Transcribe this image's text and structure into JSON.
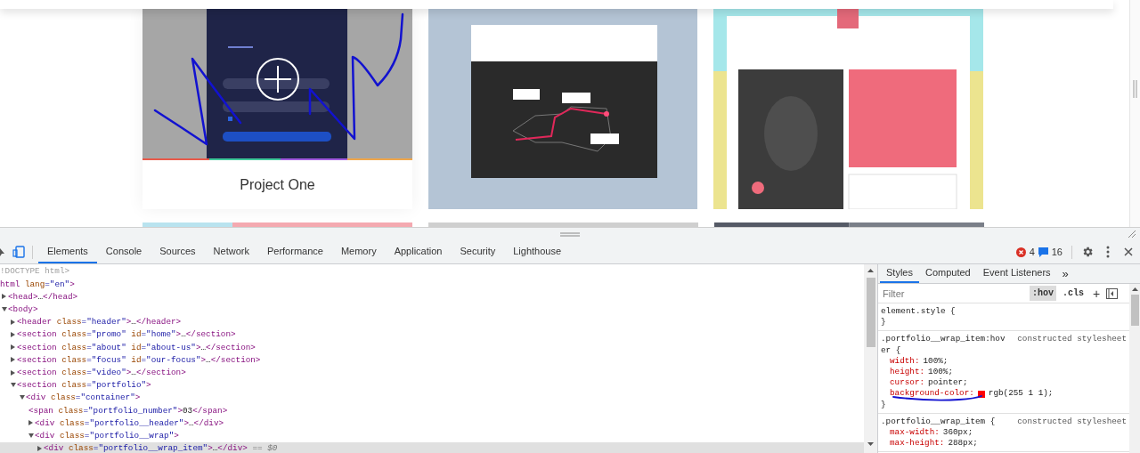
{
  "page": {
    "cards": [
      {
        "title": "Project One"
      }
    ]
  },
  "devtools": {
    "tabs": [
      {
        "label": "Elements",
        "selected": true
      },
      {
        "label": "Console",
        "selected": false
      },
      {
        "label": "Sources",
        "selected": false
      },
      {
        "label": "Network",
        "selected": false
      },
      {
        "label": "Performance",
        "selected": false
      },
      {
        "label": "Memory",
        "selected": false
      },
      {
        "label": "Application",
        "selected": false
      },
      {
        "label": "Security",
        "selected": false
      },
      {
        "label": "Lighthouse",
        "selected": false
      }
    ],
    "errors": "4",
    "messages": "16",
    "tree": [
      {
        "kind": "plain",
        "selected": false,
        "parts": [
          {
            "kind": "dim",
            "text": "!DOCTYPE html>"
          }
        ]
      },
      {
        "kind": "plain",
        "selected": false,
        "parts": [
          {
            "kind": "tag",
            "text": "html"
          },
          {
            "kind": "attr",
            "text": " lang"
          },
          {
            "kind": "value",
            "text": "=\"en\""
          },
          {
            "kind": "tag",
            "text": ">"
          }
        ],
        "children": [
          {
            "kind": "toggle",
            "expanded": false,
            "selected": false,
            "parts": [
              {
                "kind": "tag",
                "text": "<head>"
              },
              {
                "kind": "text",
                "text": "…"
              },
              {
                "kind": "tag",
                "text": "</head>"
              }
            ]
          },
          {
            "kind": "toggle",
            "expanded": true,
            "selected": false,
            "parts": [
              {
                "kind": "tag",
                "text": "<body>"
              }
            ],
            "children": [
              {
                "kind": "toggle",
                "expanded": false,
                "selected": false,
                "parts": [
                  {
                    "kind": "tag",
                    "text": "<header"
                  },
                  {
                    "kind": "attr",
                    "text": " class"
                  },
                  {
                    "kind": "value",
                    "text": "=\"header\""
                  },
                  {
                    "kind": "tag",
                    "text": ">"
                  },
                  {
                    "kind": "text",
                    "text": "…"
                  },
                  {
                    "kind": "tag",
                    "text": "</header>"
                  }
                ]
              },
              {
                "kind": "toggle",
                "expanded": false,
                "selected": false,
                "parts": [
                  {
                    "kind": "tag",
                    "text": "<section"
                  },
                  {
                    "kind": "attr",
                    "text": " class"
                  },
                  {
                    "kind": "value",
                    "text": "=\"promo\""
                  },
                  {
                    "kind": "attr",
                    "text": " id"
                  },
                  {
                    "kind": "value",
                    "text": "=\"home\""
                  },
                  {
                    "kind": "tag",
                    "text": ">"
                  },
                  {
                    "kind": "text",
                    "text": "…"
                  },
                  {
                    "kind": "tag",
                    "text": "</section>"
                  }
                ]
              },
              {
                "kind": "toggle",
                "expanded": false,
                "selected": false,
                "parts": [
                  {
                    "kind": "tag",
                    "text": "<section"
                  },
                  {
                    "kind": "attr",
                    "text": " class"
                  },
                  {
                    "kind": "value",
                    "text": "=\"about\""
                  },
                  {
                    "kind": "attr",
                    "text": " id"
                  },
                  {
                    "kind": "value",
                    "text": "=\"about-us\""
                  },
                  {
                    "kind": "tag",
                    "text": ">"
                  },
                  {
                    "kind": "text",
                    "text": "…"
                  },
                  {
                    "kind": "tag",
                    "text": "</section>"
                  }
                ]
              },
              {
                "kind": "toggle",
                "expanded": false,
                "selected": false,
                "parts": [
                  {
                    "kind": "tag",
                    "text": "<section"
                  },
                  {
                    "kind": "attr",
                    "text": " class"
                  },
                  {
                    "kind": "value",
                    "text": "=\"focus\""
                  },
                  {
                    "kind": "attr",
                    "text": " id"
                  },
                  {
                    "kind": "value",
                    "text": "=\"our-focus\""
                  },
                  {
                    "kind": "tag",
                    "text": ">"
                  },
                  {
                    "kind": "text",
                    "text": "…"
                  },
                  {
                    "kind": "tag",
                    "text": "</section>"
                  }
                ]
              },
              {
                "kind": "toggle",
                "expanded": false,
                "selected": false,
                "parts": [
                  {
                    "kind": "tag",
                    "text": "<section"
                  },
                  {
                    "kind": "attr",
                    "text": " class"
                  },
                  {
                    "kind": "value",
                    "text": "=\"video\""
                  },
                  {
                    "kind": "tag",
                    "text": ">"
                  },
                  {
                    "kind": "text",
                    "text": "…"
                  },
                  {
                    "kind": "tag",
                    "text": "</section>"
                  }
                ]
              },
              {
                "kind": "toggle",
                "expanded": true,
                "selected": false,
                "parts": [
                  {
                    "kind": "tag",
                    "text": "<section"
                  },
                  {
                    "kind": "attr",
                    "text": " class"
                  },
                  {
                    "kind": "value",
                    "text": "=\"portfolio\""
                  },
                  {
                    "kind": "tag",
                    "text": ">"
                  }
                ],
                "children": [
                  {
                    "kind": "toggle",
                    "expanded": true,
                    "selected": false,
                    "parts": [
                      {
                        "kind": "tag",
                        "text": "<div"
                      },
                      {
                        "kind": "attr",
                        "text": " class"
                      },
                      {
                        "kind": "value",
                        "text": "=\"container\""
                      },
                      {
                        "kind": "tag",
                        "text": ">"
                      }
                    ],
                    "children": [
                      {
                        "kind": "plain",
                        "selected": false,
                        "parts": [
                          {
                            "kind": "tag",
                            "text": "<span"
                          },
                          {
                            "kind": "attr",
                            "text": " class"
                          },
                          {
                            "kind": "value",
                            "text": "=\"portfolio_number\""
                          },
                          {
                            "kind": "tag",
                            "text": ">"
                          },
                          {
                            "kind": "text",
                            "text": "03"
                          },
                          {
                            "kind": "tag",
                            "text": "</span>"
                          }
                        ]
                      },
                      {
                        "kind": "toggle",
                        "expanded": false,
                        "selected": false,
                        "parts": [
                          {
                            "kind": "tag",
                            "text": "<div"
                          },
                          {
                            "kind": "attr",
                            "text": " class"
                          },
                          {
                            "kind": "value",
                            "text": "=\"portfolio__header\""
                          },
                          {
                            "kind": "tag",
                            "text": ">"
                          },
                          {
                            "kind": "text",
                            "text": "…"
                          },
                          {
                            "kind": "tag",
                            "text": "</div>"
                          }
                        ]
                      },
                      {
                        "kind": "toggle",
                        "expanded": true,
                        "selected": false,
                        "parts": [
                          {
                            "kind": "tag",
                            "text": "<div"
                          },
                          {
                            "kind": "attr",
                            "text": " class"
                          },
                          {
                            "kind": "value",
                            "text": "=\"portfolio__wrap\""
                          },
                          {
                            "kind": "tag",
                            "text": ">"
                          }
                        ],
                        "children": [
                          {
                            "kind": "toggle",
                            "expanded": false,
                            "selected": true,
                            "parts": [
                              {
                                "kind": "tag",
                                "text": "<div"
                              },
                              {
                                "kind": "attr",
                                "text": " class"
                              },
                              {
                                "kind": "value",
                                "text": "=\"portfolio__wrap_item\""
                              },
                              {
                                "kind": "tag",
                                "text": ">"
                              },
                              {
                                "kind": "text",
                                "text": "…"
                              },
                              {
                                "kind": "tag",
                                "text": "</div>"
                              },
                              {
                                "kind": "note",
                                "text": " == $0"
                              }
                            ]
                          }
                        ]
                      }
                    ]
                  }
                ]
              }
            ]
          }
        ]
      }
    ],
    "sidebar": {
      "tabs": [
        {
          "label": "Styles",
          "selected": true
        },
        {
          "label": "Computed",
          "selected": false
        },
        {
          "label": "Event Listeners",
          "selected": false
        }
      ],
      "more": "»",
      "filter_placeholder": "Filter",
      "toggles": [
        {
          "label": ":hov",
          "selected": true
        },
        {
          "label": ".cls",
          "selected": false
        }
      ],
      "add": "+",
      "rules": [
        {
          "selector": "element.style {",
          "close": "}"
        },
        {
          "selector": ".portfolio__wrap_item:hover {",
          "source": "constructed stylesheet",
          "close": "}",
          "props": [
            {
              "name": "width:",
              "value": "100%;"
            },
            {
              "name": "height:",
              "value": "100%;"
            },
            {
              "name": "cursor:",
              "value": "pointer;"
            },
            {
              "name": "background-color:",
              "color": "#ff0101",
              "value": "rgb(255 1 1);"
            }
          ]
        },
        {
          "selector": ".portfolio__wrap_item {",
          "source": "constructed stylesheet",
          "props": [
            {
              "name": "max-width:",
              "value": "360px;"
            },
            {
              "name": "max-height:",
              "value": "288px;"
            }
          ]
        }
      ]
    }
  }
}
